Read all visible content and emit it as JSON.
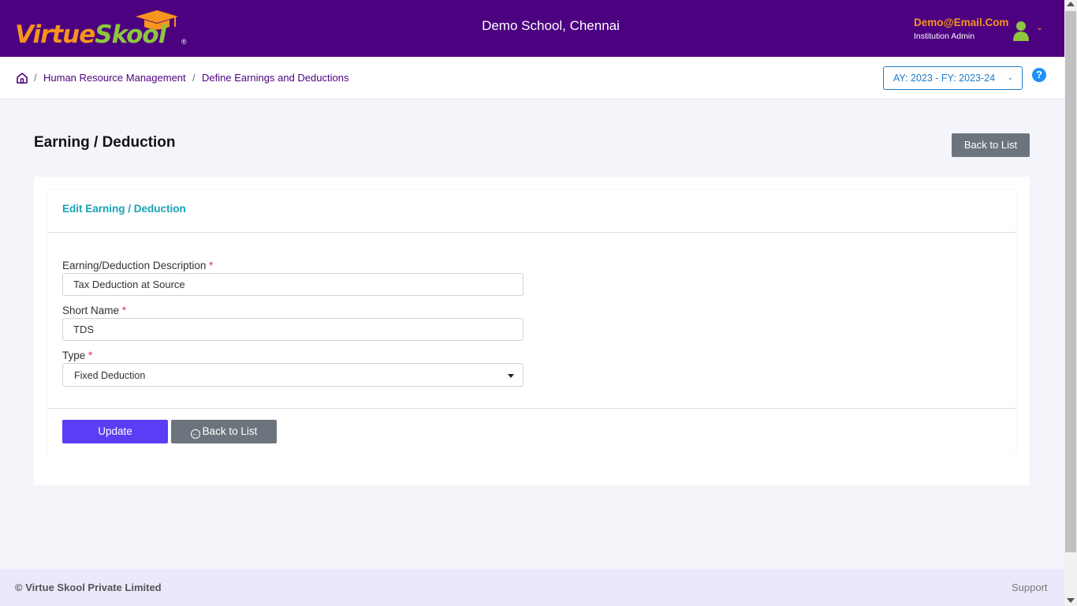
{
  "header": {
    "logo_part1": "Virtue",
    "logo_part2": "Skool",
    "logo_reg": "®",
    "school_name": "Demo School, Chennai",
    "user_email": "Demo@Email.Com",
    "user_role": "Institution Admin",
    "colors": {
      "bar": "#4c0180",
      "accent": "#f7941d",
      "green": "#8dc63f"
    }
  },
  "breadcrumb": {
    "separator": "/",
    "items": [
      "Human Resource Management",
      "Define Earnings and Deductions"
    ],
    "ay_select": "AY: 2023 - FY: 2023-24",
    "help_icon": "?"
  },
  "page": {
    "title": "Earning / Deduction",
    "back_top_label": "Back to List"
  },
  "form": {
    "card_title": "Edit Earning / Deduction",
    "required_mark": "*",
    "description_label": "Earning/Deduction Description",
    "description_value": "Tax Deduction at Source",
    "short_name_label": "Short Name",
    "short_name_value": "TDS",
    "type_label": "Type",
    "type_value": "Fixed Deduction",
    "update_label": "Update",
    "back_label": "Back to List",
    "colors": {
      "title": "#17a2b8",
      "update": "#5b3df5",
      "secondary": "#6c757d"
    }
  },
  "footer": {
    "copyright": "© Virtue Skool Private Limited",
    "support": "Support"
  }
}
